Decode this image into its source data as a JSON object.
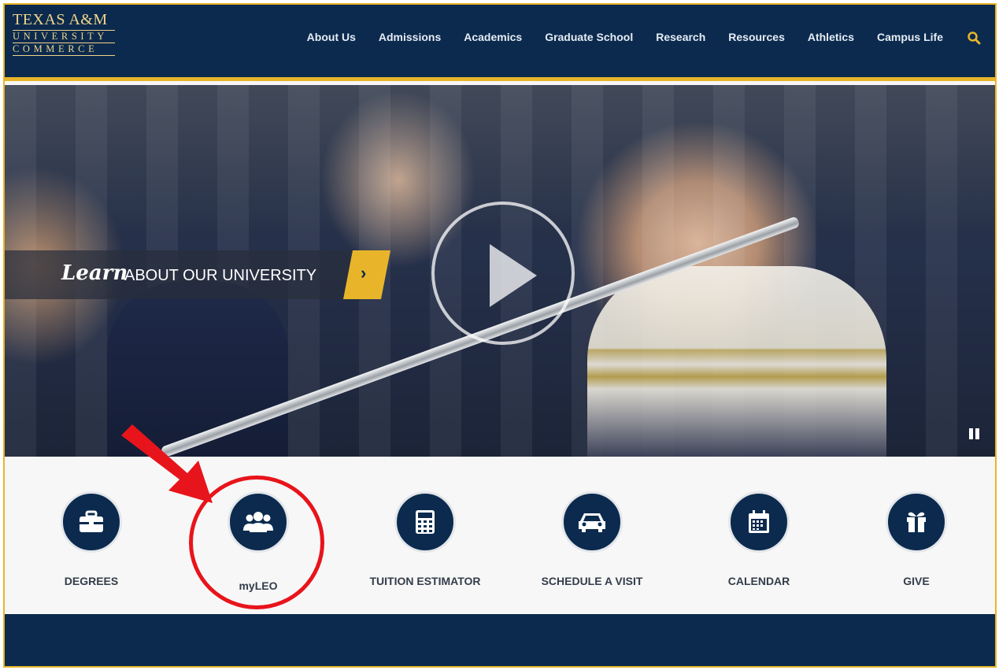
{
  "logo": {
    "line1": "TEXAS A&M",
    "line2": "UNIVERSITY",
    "line3": "COMMERCE"
  },
  "nav": {
    "items": [
      "About Us",
      "Admissions",
      "Academics",
      "Graduate School",
      "Research",
      "Resources",
      "Athletics",
      "Campus Life"
    ],
    "search_icon": "search-icon"
  },
  "hero": {
    "learn_script": "Learn",
    "learn_rest": "ABOUT OUR UNIVERSITY",
    "arrow": "›"
  },
  "quick_links": [
    {
      "label": "DEGREES",
      "icon": "briefcase-icon"
    },
    {
      "label": "myLEO",
      "icon": "users-icon"
    },
    {
      "label": "TUITION ESTIMATOR",
      "icon": "calculator-icon"
    },
    {
      "label": "SCHEDULE A VISIT",
      "icon": "car-icon"
    },
    {
      "label": "CALENDAR",
      "icon": "calendar-icon"
    },
    {
      "label": "GIVE",
      "icon": "gift-icon"
    }
  ],
  "colors": {
    "navy": "#0b2a4e",
    "gold": "#e8b52a",
    "annotation": "#e8141b"
  }
}
